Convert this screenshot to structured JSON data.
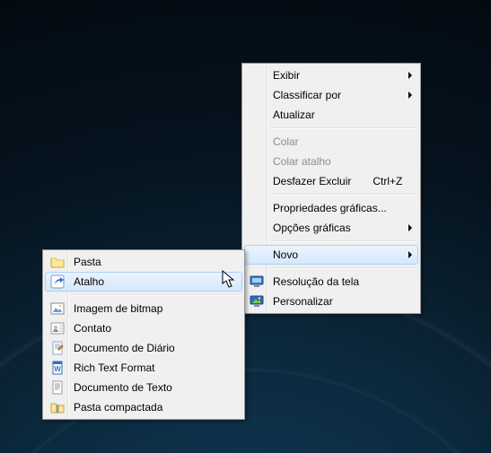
{
  "main_menu": {
    "view": {
      "label": "Exibir"
    },
    "sort_by": {
      "label": "Classificar por"
    },
    "refresh": {
      "label": "Atualizar"
    },
    "paste": {
      "label": "Colar"
    },
    "paste_shortcut": {
      "label": "Colar atalho"
    },
    "undo_delete": {
      "label": "Desfazer Excluir",
      "shortcut": "Ctrl+Z"
    },
    "gfx_props": {
      "label": "Propriedades gráficas..."
    },
    "gfx_options": {
      "label": "Opções gráficas"
    },
    "new": {
      "label": "Novo"
    },
    "screen_res": {
      "label": "Resolução da tela"
    },
    "personalize": {
      "label": "Personalizar"
    }
  },
  "sub_menu": {
    "folder": {
      "label": "Pasta"
    },
    "shortcut": {
      "label": "Atalho"
    },
    "bitmap": {
      "label": "Imagem de bitmap"
    },
    "contact": {
      "label": "Contato"
    },
    "journal": {
      "label": "Documento de Diário"
    },
    "rtf": {
      "label": "Rich Text Format"
    },
    "textdoc": {
      "label": "Documento de Texto"
    },
    "zip": {
      "label": "Pasta compactada"
    }
  }
}
